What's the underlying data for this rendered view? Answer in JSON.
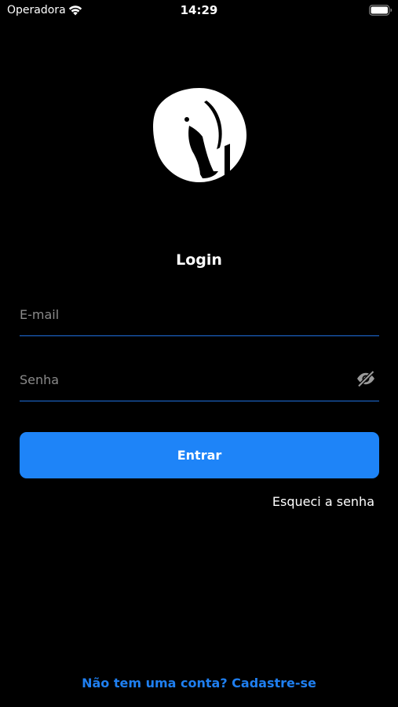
{
  "status_bar": {
    "carrier": "Operadora",
    "time": "14:29",
    "wifi_icon": "wifi-icon",
    "battery_icon": "battery-icon"
  },
  "logo": {
    "icon": "elephant-logo-icon"
  },
  "login": {
    "title": "Login",
    "email": {
      "value": "",
      "placeholder": "E-mail"
    },
    "password": {
      "value": "",
      "placeholder": "Senha",
      "toggle_icon": "eye-off-icon"
    },
    "submit_label": "Entrar",
    "forgot_label": "Esqueci a senha",
    "signup_label": "Não tem uma conta? Cadastre-se"
  },
  "colors": {
    "background": "#000000",
    "accent": "#1e84f8",
    "field_underline": "#1f6fde",
    "placeholder": "#8a8a8a",
    "text": "#ffffff"
  }
}
